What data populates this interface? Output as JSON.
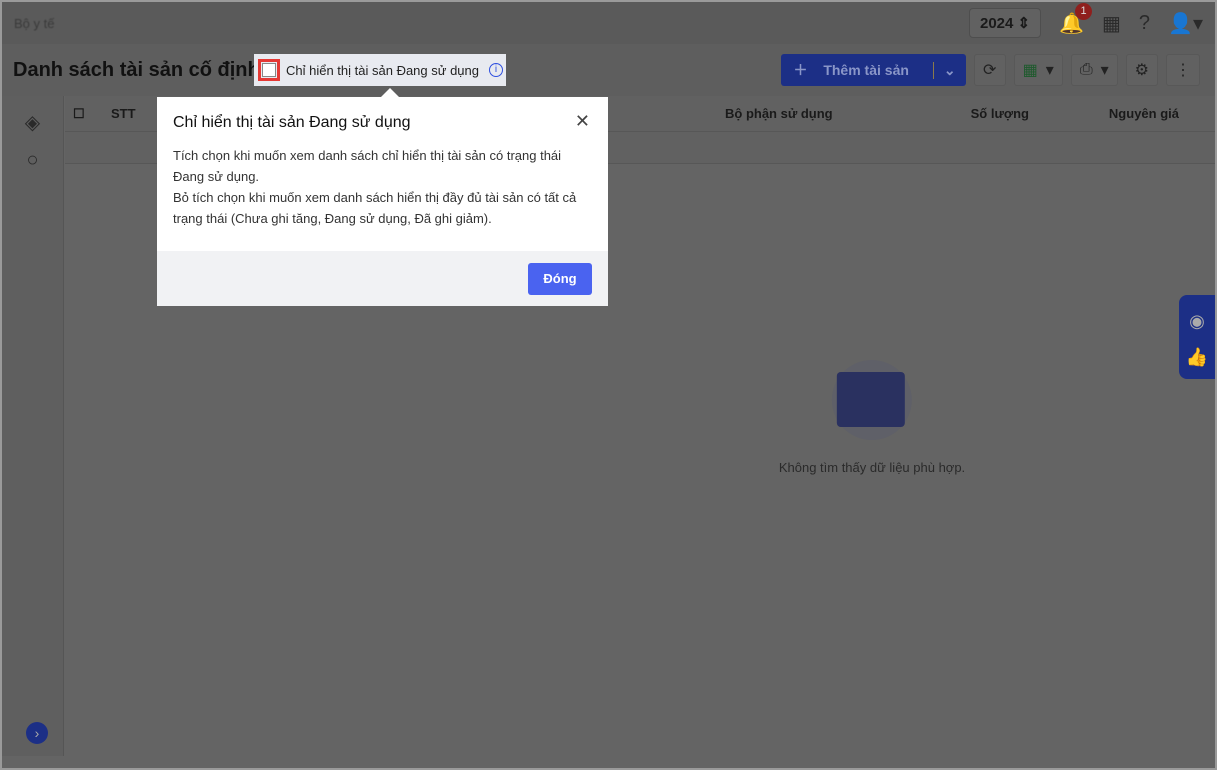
{
  "topbar": {
    "org": "Bộ y tế",
    "year": "2024",
    "notif_count": "1"
  },
  "page": {
    "title": "Danh sách tài sản cố định"
  },
  "toolbar": {
    "add_label": "Thêm tài sản"
  },
  "filter": {
    "label": "Chỉ hiển thị tài sản Đang sử dụng"
  },
  "table": {
    "columns": [
      "STT",
      "Bộ phận sử dụng",
      "Số lượng",
      "Nguyên giá"
    ],
    "eq": "="
  },
  "empty": {
    "text": "Không tìm thấy dữ liệu phù hợp."
  },
  "popover": {
    "title": "Chỉ hiển thị tài sản Đang sử dụng",
    "line1": "Tích chọn khi muốn xem danh sách chỉ hiển thị tài sản có trạng thái Đang sử dụng.",
    "line2": "Bỏ tích chọn khi muốn xem danh sách hiển thị đầy đủ tài sản có tất cả trạng thái (Chưa ghi tăng, Đang sử dụng, Đã ghi giảm).",
    "close_label": "Đóng"
  }
}
